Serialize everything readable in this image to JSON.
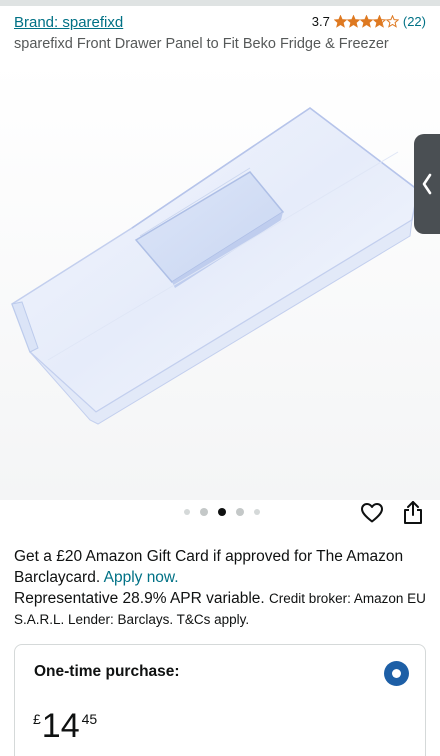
{
  "header": {
    "brand_link": "Brand: sparefixd",
    "rating_value": "3.7",
    "rating_stars": 3.7,
    "rating_count": "(22)",
    "product_title": "sparefixd Front Drawer Panel to Fit Beko Fridge & Freezer"
  },
  "gallery": {
    "image_subject": "transparent fridge drawer front panel",
    "dot_count": 5,
    "active_dot": 3,
    "side_tab_icon": "chevron-left-icon",
    "favorite_icon": "heart-icon",
    "share_icon": "share-icon"
  },
  "promo": {
    "line_text": "Get a £20 Amazon Gift Card if approved for The Amazon Barclaycard.",
    "apply_link": "Apply now.",
    "apr_text": "Representative 28.9% APR variable.",
    "broker_text": "Credit broker: Amazon EU S.A.R.L. Lender: Barclays. T&Cs apply."
  },
  "purchase": {
    "label": "One-time purchase:",
    "selected": true,
    "currency": "£",
    "price_whole": "14",
    "price_fraction": "45"
  },
  "colors": {
    "link": "#007185",
    "star": "#de7921",
    "radio": "#1d5fa6",
    "text": "#0f1111"
  }
}
